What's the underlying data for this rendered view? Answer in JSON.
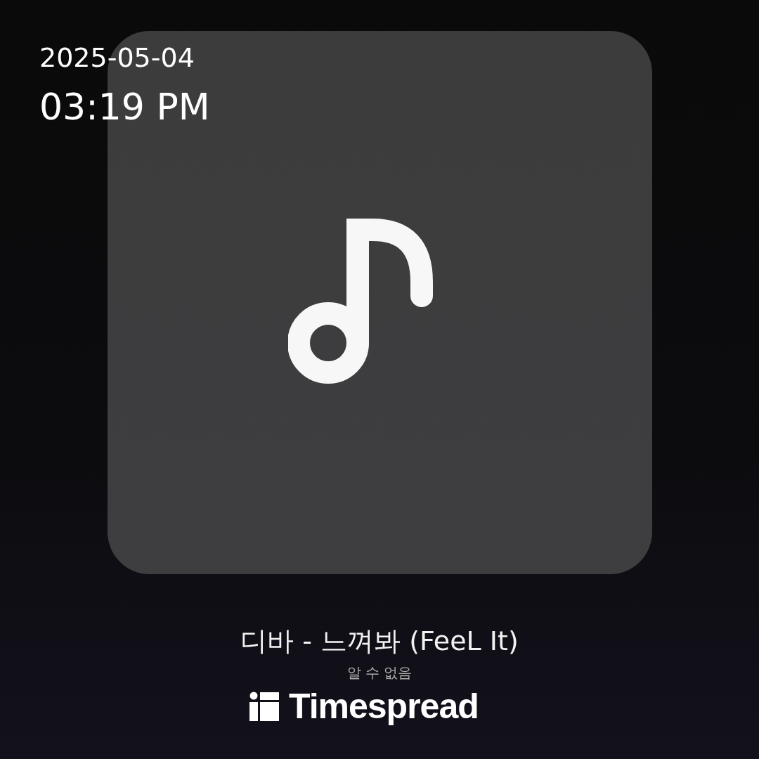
{
  "stamp": {
    "date": "2025-05-04",
    "time": "03:19 PM",
    "logo": "Timespread"
  },
  "track": {
    "title": "디바 - 느껴봐 (FeeL It)",
    "artist": "알 수 없음"
  }
}
